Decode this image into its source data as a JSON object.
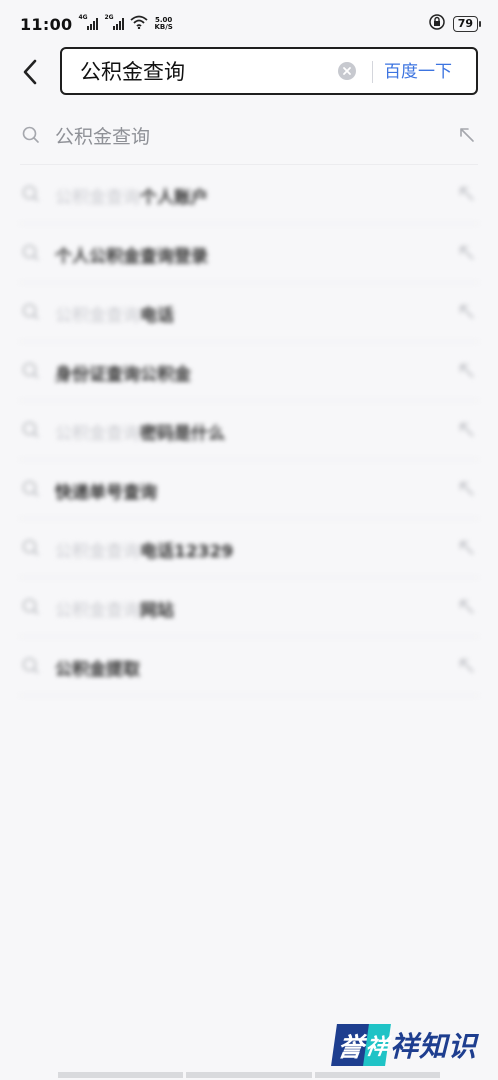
{
  "status_bar": {
    "time": "11:00",
    "signal1_tag": "4G",
    "signal2_tag": "2G",
    "speed_value": "5.00",
    "speed_unit": "KB/S",
    "battery": "79"
  },
  "search": {
    "query": "公积金查询",
    "submit_label": "百度一下"
  },
  "suggestions": [
    {
      "parts": [
        {
          "text": "公积金查询",
          "style": "plain"
        }
      ],
      "clear": true
    },
    {
      "parts": [
        {
          "text": "公积金查询",
          "style": "light"
        },
        {
          "text": "个人账户",
          "style": "dark"
        }
      ]
    },
    {
      "parts": [
        {
          "text": "个人公积金查询登录",
          "style": "dark"
        }
      ]
    },
    {
      "parts": [
        {
          "text": "公积金查询",
          "style": "light"
        },
        {
          "text": "电话",
          "style": "dark"
        }
      ]
    },
    {
      "parts": [
        {
          "text": "身份证查询公积金",
          "style": "dark"
        }
      ]
    },
    {
      "parts": [
        {
          "text": "公积金查询",
          "style": "light"
        },
        {
          "text": "密码是什么",
          "style": "dark"
        }
      ]
    },
    {
      "parts": [
        {
          "text": "快递单号查询",
          "style": "dark"
        }
      ]
    },
    {
      "parts": [
        {
          "text": "公积金查询",
          "style": "light"
        },
        {
          "text": "电话12329",
          "style": "dark"
        }
      ]
    },
    {
      "parts": [
        {
          "text": "公积金查询",
          "style": "light"
        },
        {
          "text": "网站",
          "style": "dark"
        }
      ]
    },
    {
      "parts": [
        {
          "text": "公积金提取",
          "style": "dark"
        }
      ]
    }
  ],
  "watermark": {
    "char1": "誉",
    "char2": "祥",
    "rest": "祥知识"
  },
  "colors": {
    "accent": "#3c74e0",
    "background": "#f7f7f9",
    "watermark_blue": "#1e3e8f",
    "watermark_teal": "#1fc3c6"
  },
  "icons": [
    "back-arrow-icon",
    "clear-icon",
    "search-icon",
    "fill-arrow-icon",
    "wifi-icon",
    "lock-icon"
  ]
}
